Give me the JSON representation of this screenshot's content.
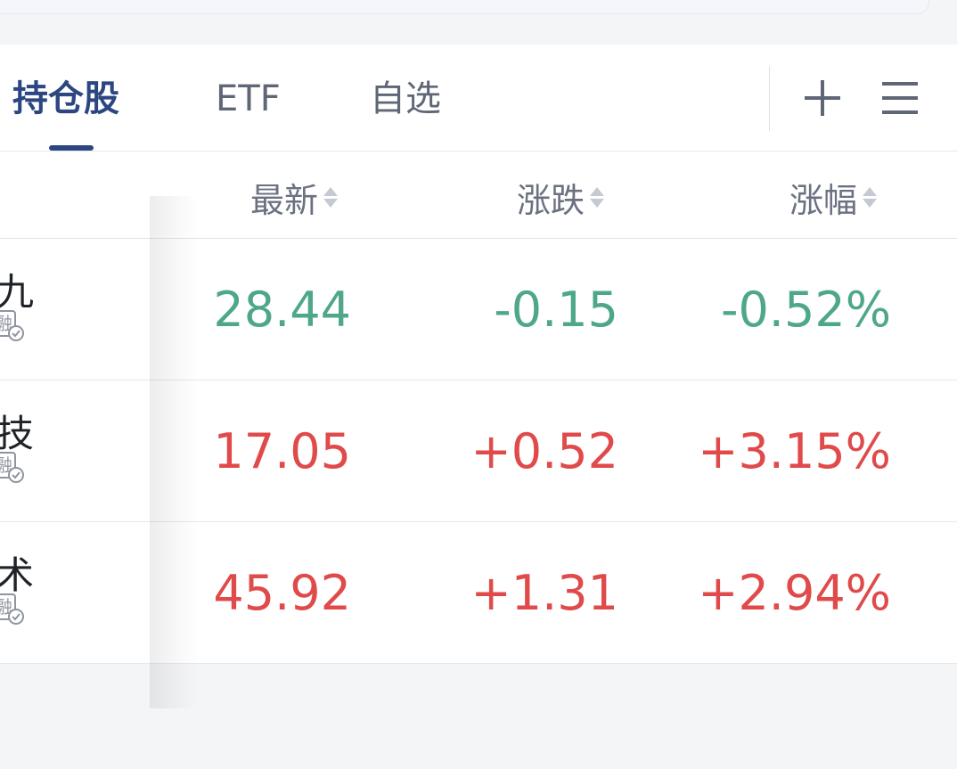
{
  "tabs": [
    {
      "label": "持仓股",
      "active": true
    },
    {
      "label": "ETF",
      "active": false
    },
    {
      "label": "自选",
      "active": false
    }
  ],
  "toolbar": {
    "add_icon": "plus-icon",
    "menu_icon": "menu-icon"
  },
  "columns": {
    "latest": "最新",
    "change": "涨跌",
    "pct": "涨幅"
  },
  "rows": [
    {
      "name_fragment": "九",
      "tag": "融",
      "latest": "28.44",
      "change": "-0.15",
      "pct": "-0.52%",
      "direction": "down"
    },
    {
      "name_fragment": "技",
      "tag": "融",
      "latest": "17.05",
      "change": "+0.52",
      "pct": "+3.15%",
      "direction": "up"
    },
    {
      "name_fragment": "术",
      "tag": "融",
      "latest": "45.92",
      "change": "+1.31",
      "pct": "+2.94%",
      "direction": "up"
    }
  ],
  "colors": {
    "accent": "#2c4682",
    "down": "#4fa78a",
    "up": "#e04a4a"
  }
}
